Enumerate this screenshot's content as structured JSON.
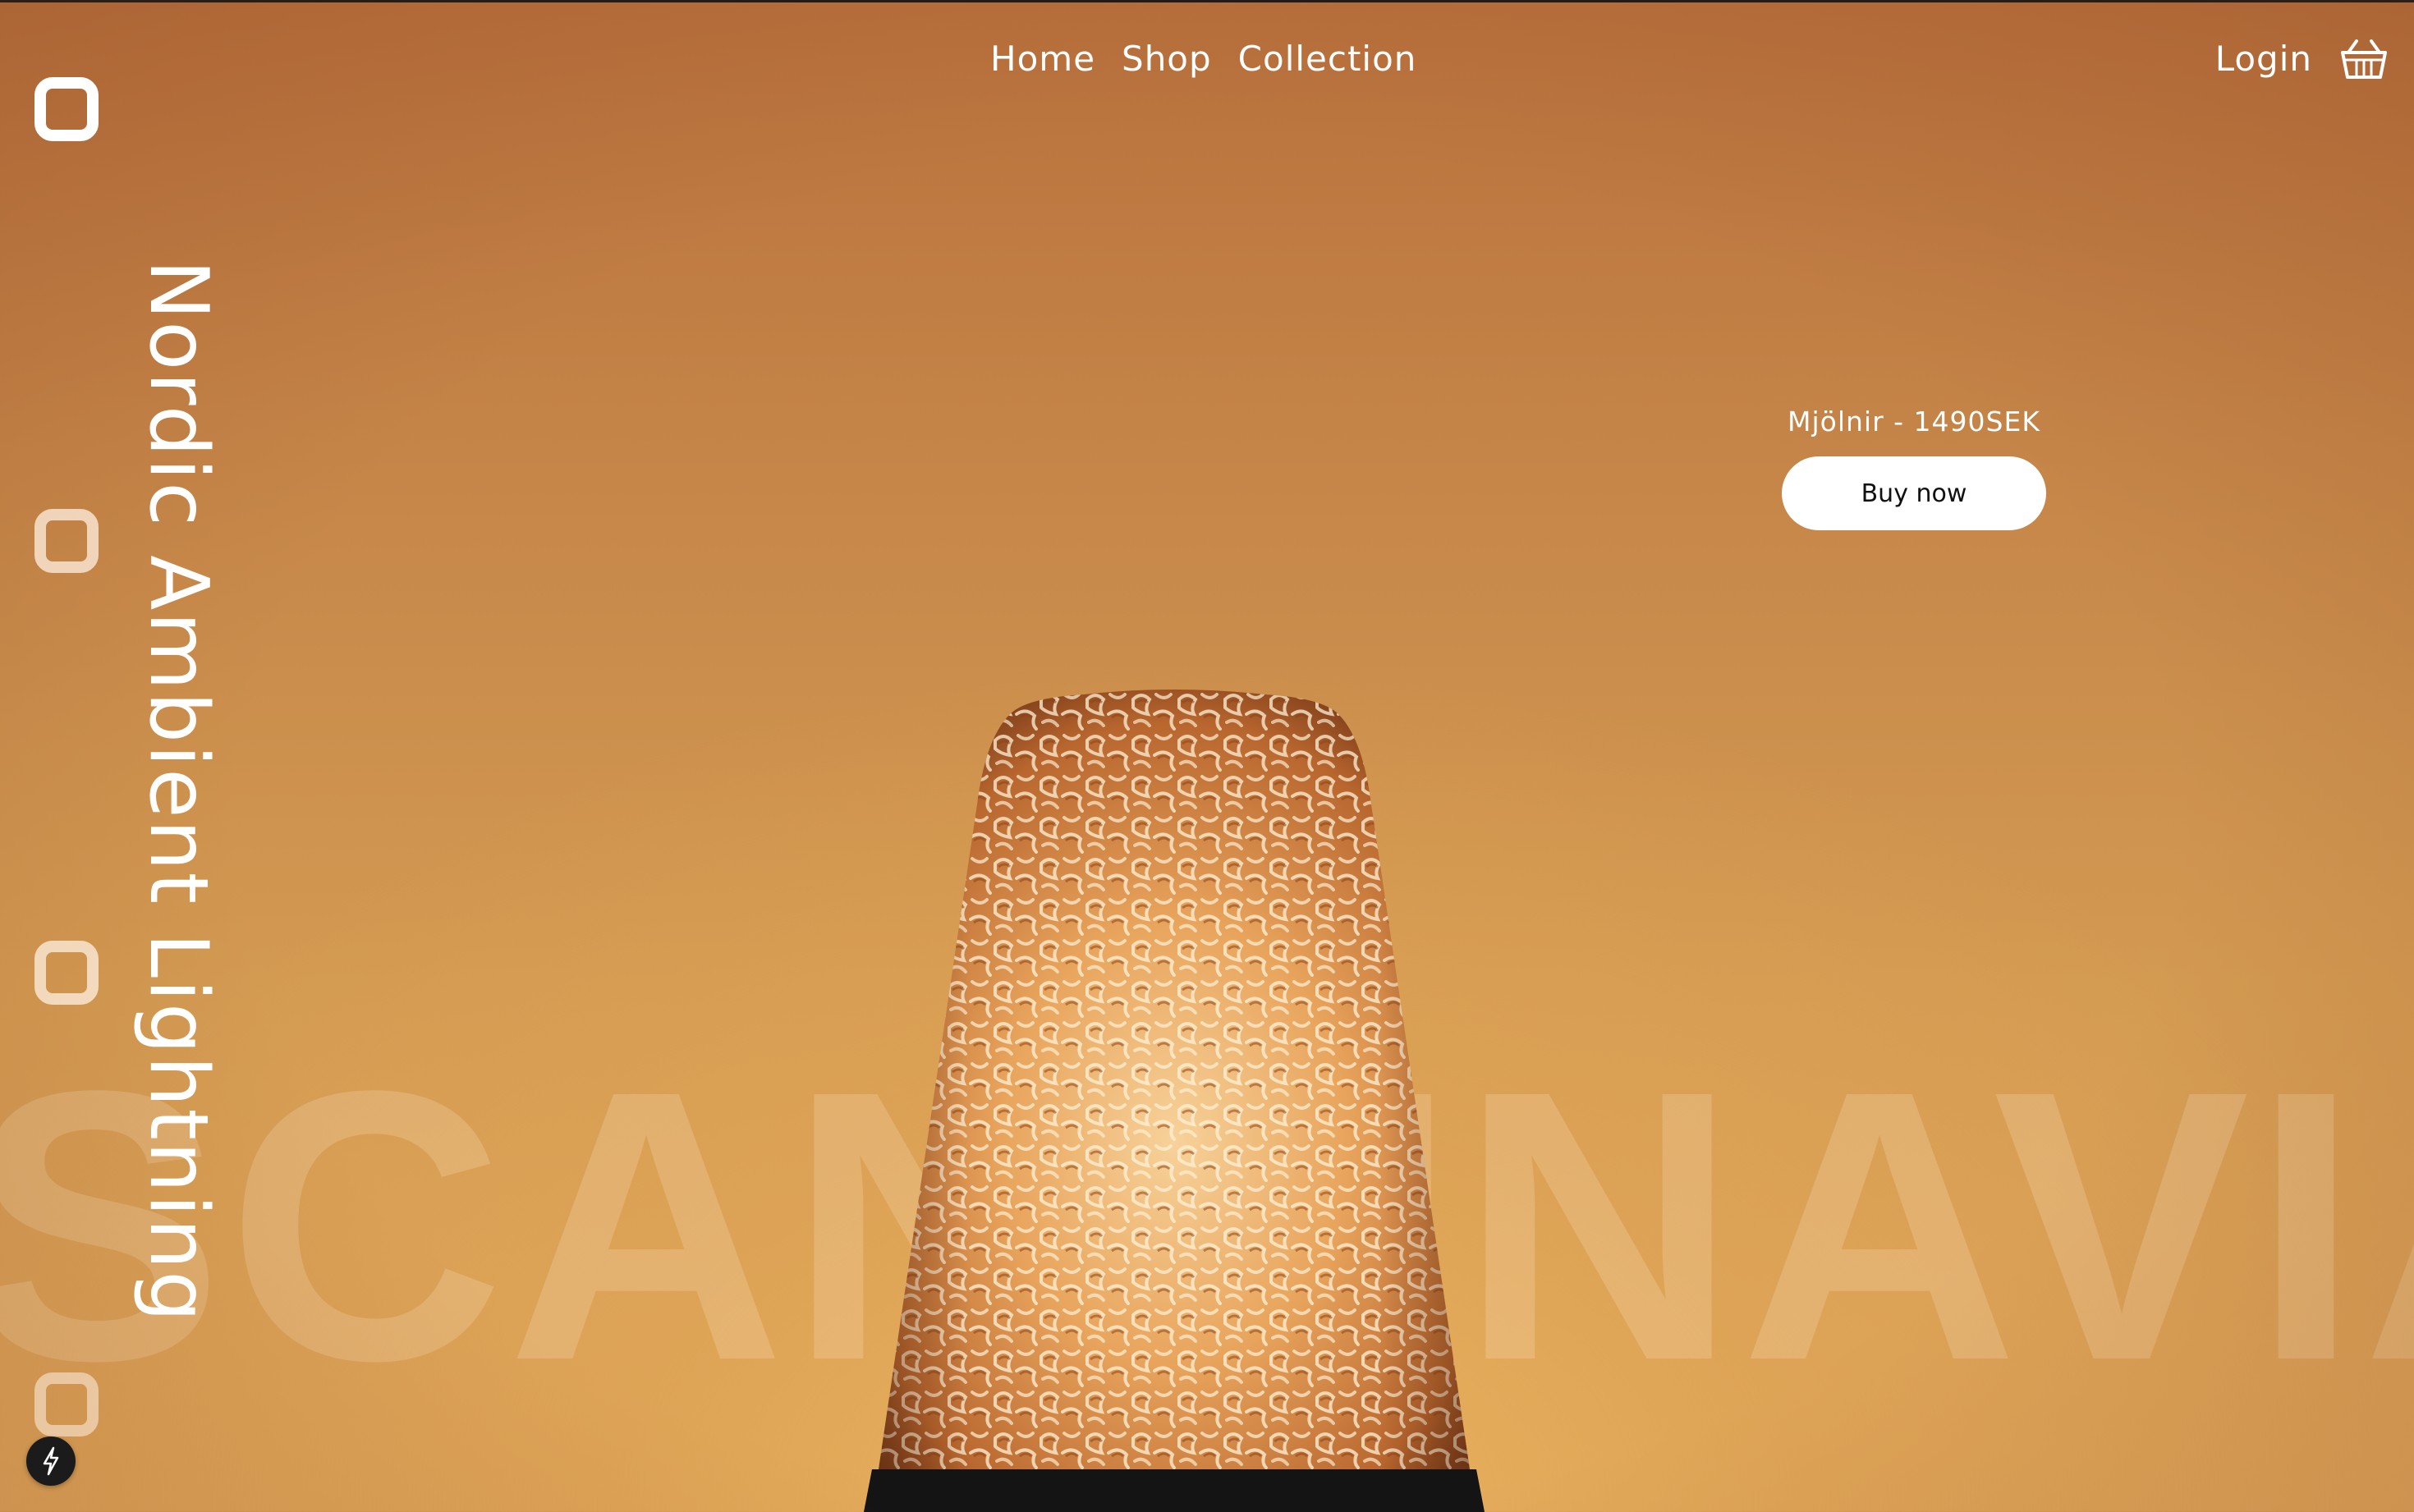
{
  "nav": {
    "links": [
      "Home",
      "Shop",
      "Collection"
    ],
    "login_label": "Login",
    "cart_icon": "basket-icon"
  },
  "hero": {
    "vertical_title": "Nordic Ambient Lightning",
    "background_word": "SCANDINAVIA",
    "product_label": "Mjölnir - 1490SEK",
    "buy_label": "Buy now"
  },
  "side_nav": {
    "items": [
      "square-icon",
      "square-icon",
      "square-icon",
      "square-icon"
    ]
  },
  "colors": {
    "bg_top": "#b8703c",
    "bg_bottom": "#dca45a",
    "text": "#ffffff",
    "button_bg": "#ffffff",
    "button_text": "#111111"
  },
  "icons": {
    "bolt": "lightning-bolt-icon"
  }
}
